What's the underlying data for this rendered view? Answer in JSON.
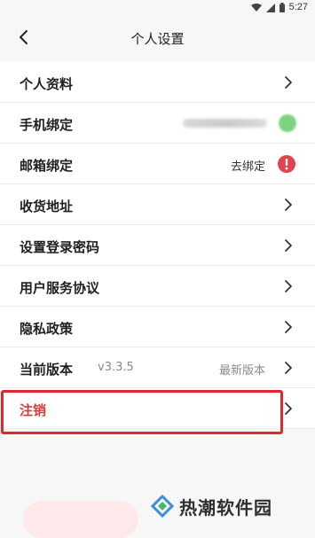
{
  "status_bar": {
    "time": "5:27"
  },
  "header": {
    "title": "个人设置"
  },
  "rows": [
    {
      "label": "个人资料"
    },
    {
      "label": "手机绑定"
    },
    {
      "label": "邮箱绑定",
      "value": "去绑定"
    },
    {
      "label": "收货地址"
    },
    {
      "label": "设置登录密码"
    },
    {
      "label": "用户服务协议"
    },
    {
      "label": "隐私政策"
    },
    {
      "label": "当前版本",
      "version": "v3.3.5",
      "value": "最新版本"
    },
    {
      "label": "注销"
    }
  ],
  "watermark": {
    "text": "热潮软件园"
  },
  "colors": {
    "accent_red": "#d63b3b",
    "highlight_border": "#e0262f",
    "alert_red": "#e0454f",
    "phone_status_green": "#7ed37e"
  }
}
